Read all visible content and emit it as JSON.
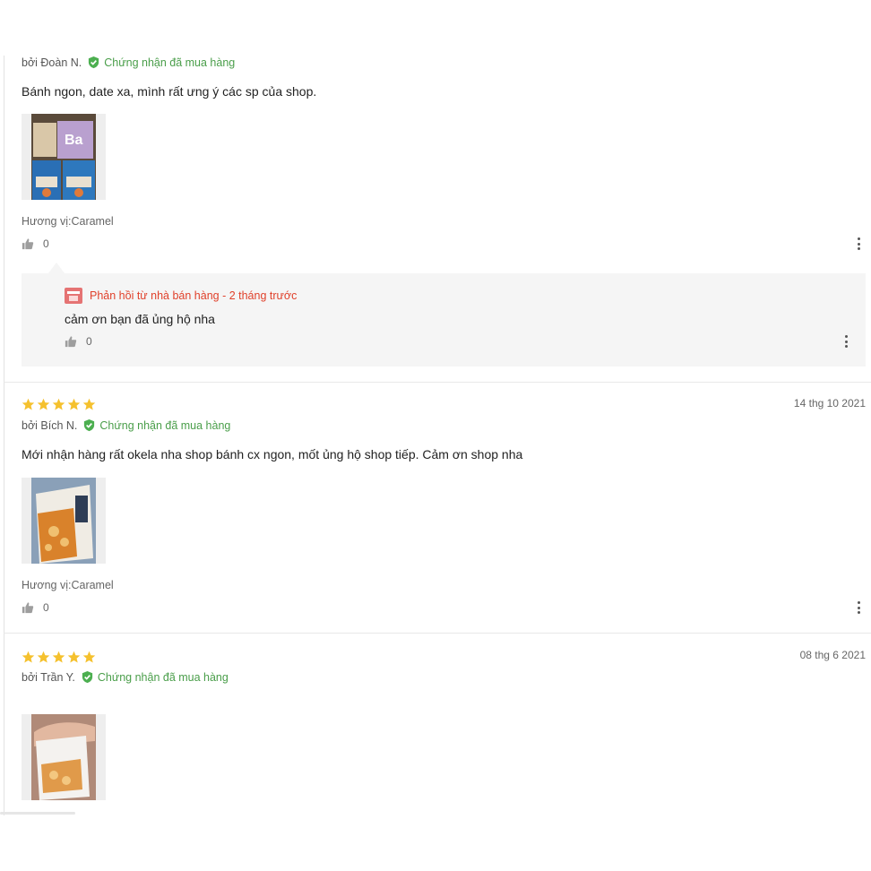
{
  "reviews": [
    {
      "author": "bởi Đoàn N.",
      "verified": "Chứng nhận đã mua hàng",
      "text": "Bánh ngon, date xa, mình rất ưng ý các sp của shop.",
      "variant": "Hương vị:Caramel",
      "likes": "0",
      "image": "product-photo-bags",
      "reply": {
        "heading": "Phản hồi từ nhà bán hàng - 2 tháng trước",
        "text": "cảm ơn bạn đã ủng hộ nha",
        "likes": "0"
      }
    },
    {
      "rating": 5,
      "date": "14 thg 10 2021",
      "author": "bởi Bích N.",
      "verified": "Chứng nhận đã mua hàng",
      "text": "Mới nhận hàng rất okela nha shop bánh cx ngon, mốt ủng hộ shop tiếp. Cảm ơn shop nha",
      "variant": "Hương vị:Caramel",
      "likes": "0",
      "image": "product-photo-bag"
    },
    {
      "rating": 5,
      "date": "08 thg 6 2021",
      "author": "bởi Trần Y.",
      "verified": "Chứng nhận đã mua hàng",
      "image": "product-photo-hand"
    }
  ],
  "colors": {
    "star": "#f5c12e",
    "verified": "#4a9e4a",
    "reply_heading": "#e0412b",
    "reply_bg": "#f5f5f5"
  }
}
